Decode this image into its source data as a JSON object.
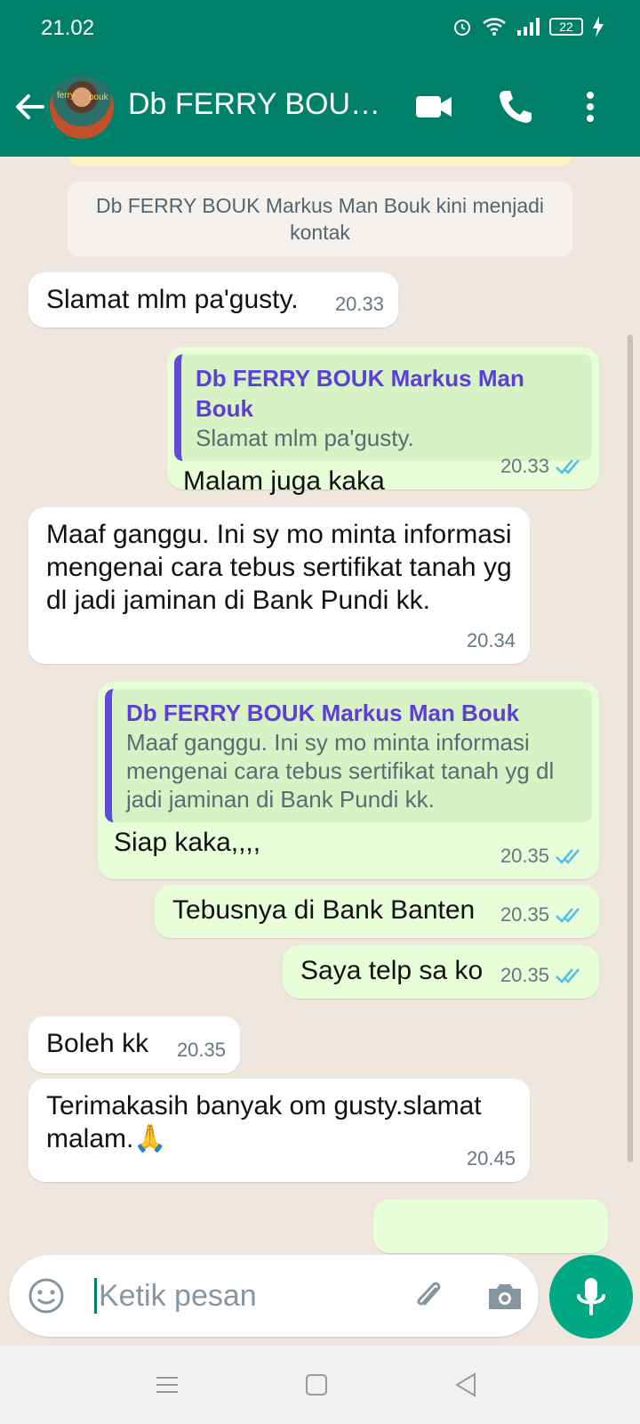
{
  "status_bar": {
    "time": "21.02",
    "battery": "22"
  },
  "header": {
    "title": "Db FERRY BOUK...",
    "avatar_text_1": "ferry",
    "avatar_text_2": "bouk"
  },
  "system_message": "Db FERRY BOUK Markus Man Bouk kini menjadi kontak",
  "messages": [
    {
      "dir": "in",
      "text": "Slamat mlm pa'gusty.",
      "time": "20.33"
    },
    {
      "dir": "out",
      "quote_name": "Db FERRY BOUK Markus Man Bouk",
      "quote_text": "Slamat mlm pa'gusty.",
      "text": "Malam juga kaka",
      "time": "20.33"
    },
    {
      "dir": "in",
      "text": "Maaf ganggu. Ini sy mo minta informasi mengenai cara tebus sertifikat tanah yg dl jadi jaminan di Bank Pundi kk.",
      "time": "20.34"
    },
    {
      "dir": "out",
      "quote_name": "Db FERRY BOUK Markus Man Bouk",
      "quote_text": "Maaf ganggu. Ini sy mo minta informasi mengenai cara tebus sertifikat tanah yg dl jadi jaminan di Bank Pundi kk.",
      "text": "Siap kaka,,,,",
      "time": "20.35"
    },
    {
      "dir": "out",
      "text": "Tebusnya di Bank Banten",
      "time": "20.35"
    },
    {
      "dir": "out",
      "text": "Saya telp sa ko",
      "time": "20.35"
    },
    {
      "dir": "in",
      "text": "Boleh kk",
      "time": "20.35"
    },
    {
      "dir": "in",
      "text": "Terimakasih banyak om gusty.slamat malam.🙏",
      "time": "20.45"
    }
  ],
  "input": {
    "placeholder": "Ketik pesan"
  },
  "colors": {
    "header": "#008069",
    "outgoing": "#e7fed8",
    "incoming": "#ffffff",
    "quote_bar": "#5d4cd8",
    "tick": "#53bdeb",
    "mic": "#00a884"
  }
}
